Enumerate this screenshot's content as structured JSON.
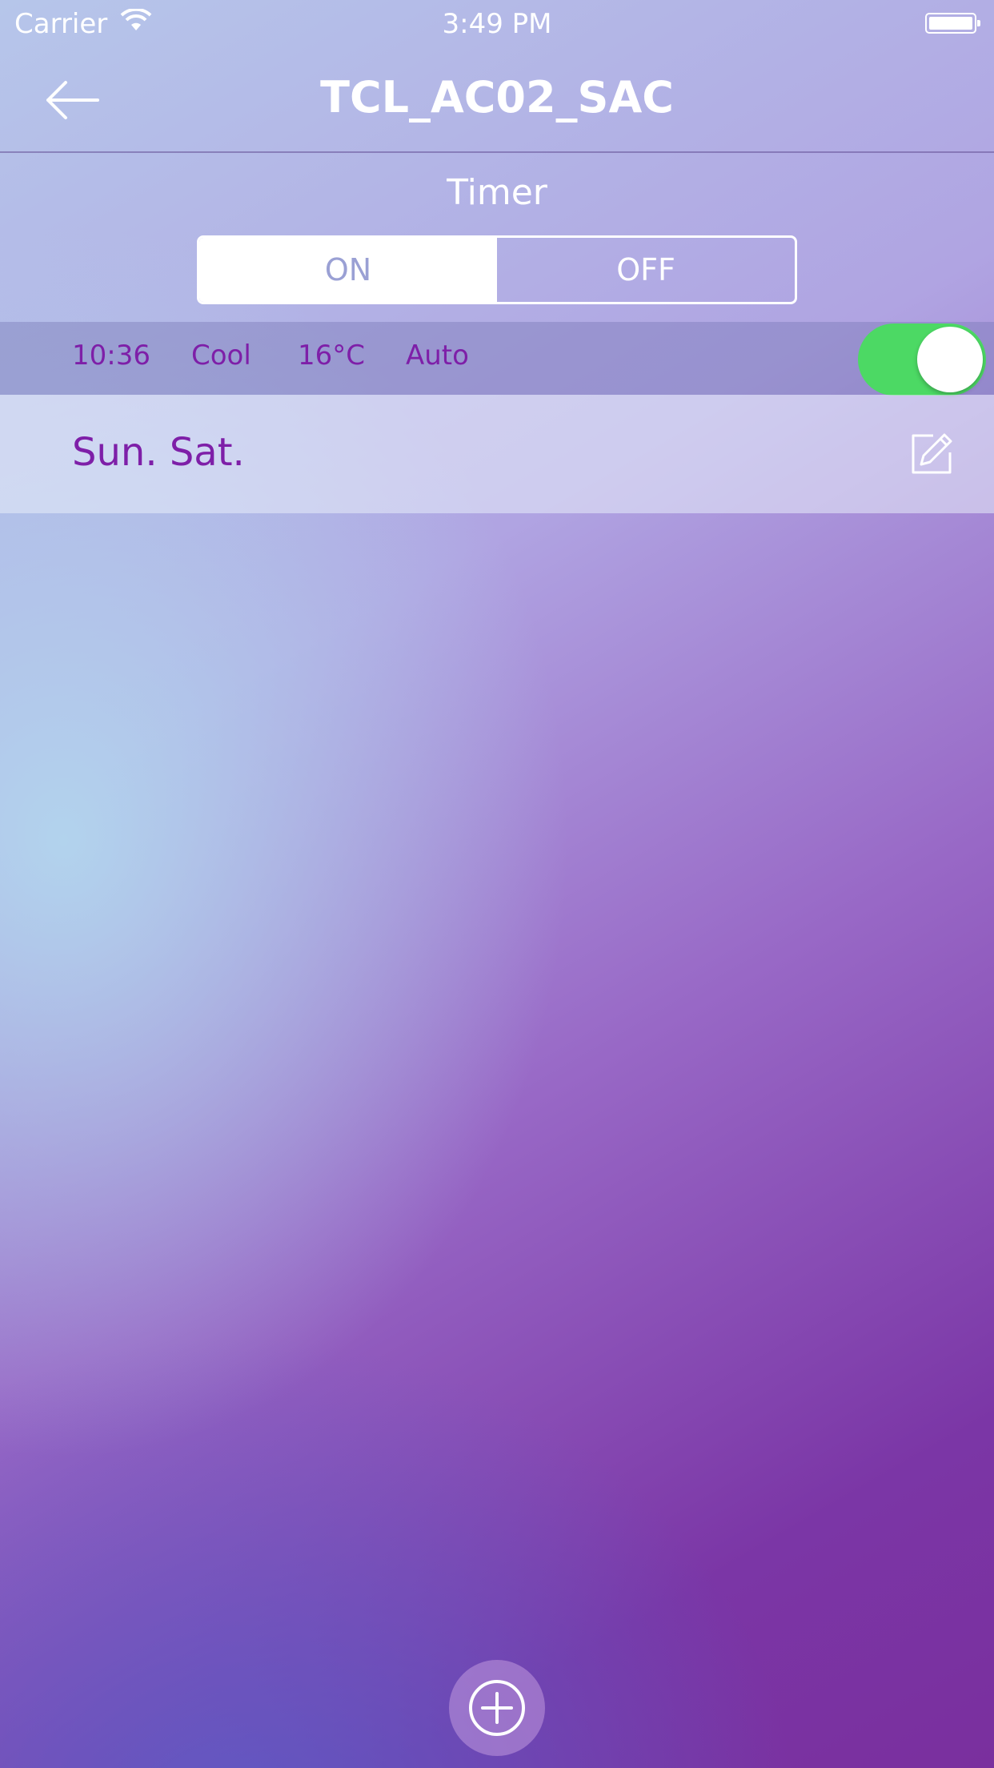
{
  "status_bar": {
    "carrier": "Carrier",
    "time": "3:49 PM",
    "wifi_icon": "wifi-icon",
    "battery_icon": "battery-icon"
  },
  "nav": {
    "title": "TCL_AC02_SAC",
    "back_icon": "arrow-left-icon"
  },
  "timer": {
    "label": "Timer",
    "tabs": [
      {
        "label": "ON",
        "selected": true
      },
      {
        "label": "OFF",
        "selected": false
      }
    ]
  },
  "timer_item": {
    "time": "10:36",
    "mode": "Cool",
    "temperature": "16°C",
    "fan": "Auto",
    "enabled": true,
    "days": "Sun. Sat.",
    "edit_icon": "pencil-edit-icon"
  },
  "add_button": {
    "icon": "plus-circle-icon"
  },
  "colors": {
    "accent_text": "#7e1fa8",
    "toggle_on": "#4cd964"
  }
}
